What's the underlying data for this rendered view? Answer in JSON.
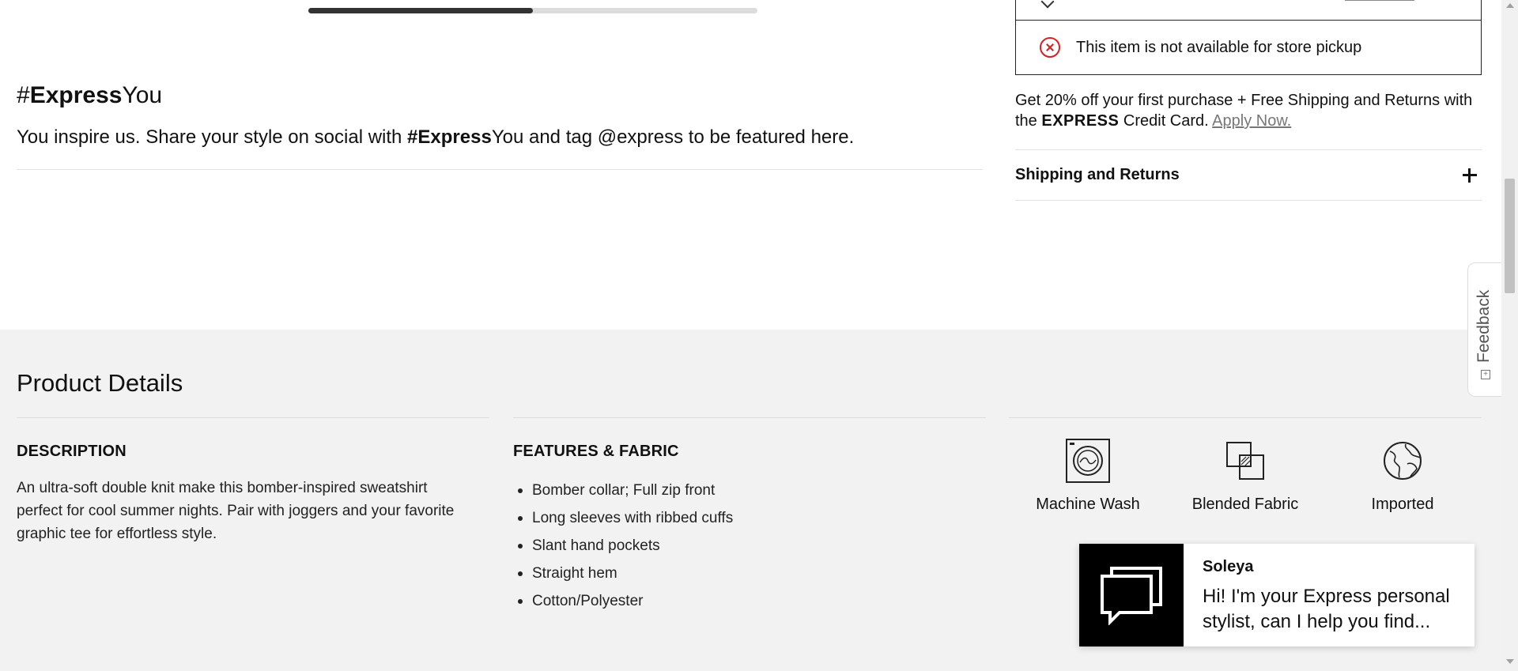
{
  "carousel": {
    "progress_percent": 50
  },
  "express_you": {
    "title_prefix": "#",
    "title_bold": "Express",
    "title_suffix": "You",
    "text_before": "You inspire us. Share your style on social with ",
    "text_hashtag_prefix": "#",
    "text_hashtag_bold": "Express",
    "text_after": "You and tag @express to be featured here."
  },
  "pickup": {
    "message": "This item is not available for store pickup",
    "icon": "error-x-circle-icon",
    "icon_color": "#d32222"
  },
  "promo": {
    "line_before": "Get 20% off your first purchase + Free Shipping and Returns with the ",
    "brand": "EXPRESS",
    "line_after": " Credit Card. ",
    "apply_label": "Apply Now."
  },
  "shipping": {
    "label": "Shipping and Returns",
    "icon": "plus-icon"
  },
  "product_details": {
    "title": "Product Details",
    "description": {
      "heading": "DESCRIPTION",
      "text": "An ultra-soft double knit make this bomber-inspired sweatshirt perfect for cool summer nights. Pair with joggers and your favorite graphic tee for effortless style."
    },
    "features": {
      "heading": "FEATURES & FABRIC",
      "items": [
        "Bomber collar; Full zip front",
        "Long sleeves with ribbed cuffs",
        "Slant hand pockets",
        "Straight hem",
        "Cotton/Polyester"
      ]
    },
    "care": [
      {
        "label": "Machine Wash",
        "icon": "machine-wash-icon"
      },
      {
        "label": "Blended Fabric",
        "icon": "blended-fabric-icon"
      },
      {
        "label": "Imported",
        "icon": "globe-icon"
      }
    ]
  },
  "chat": {
    "name": "Soleya",
    "message": "Hi! I'm your Express personal stylist, can I help you find...",
    "icon": "chat-bubbles-icon"
  },
  "feedback": {
    "label": "Feedback"
  }
}
